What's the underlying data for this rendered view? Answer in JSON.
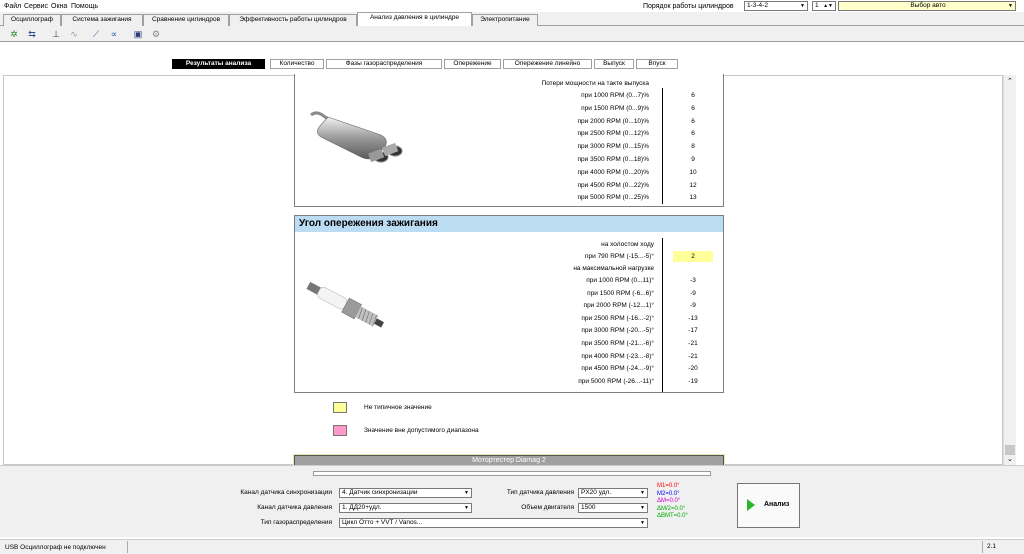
{
  "menu": {
    "items": [
      "Файл",
      "Сервис",
      "Окна",
      "Помощь"
    ]
  },
  "top_right": {
    "firing_order_label": "Порядок работы цилиндров",
    "firing_order_value": "1-3-4-2",
    "cylinder_value": "1",
    "auto_select": "Выбор авто"
  },
  "main_tabs": [
    "Осциллограф",
    "Система зажигания",
    "Сравнение цилиндров",
    "Эффективность работы цилиндров",
    "Анализ давления в цилиндре",
    "Электропитание"
  ],
  "active_main_tab": 4,
  "sub_tabs": [
    "Результаты анализа",
    "Количество",
    "Фазы газораспределения",
    "Опережение",
    "Опережение линейно",
    "Выпуск",
    "Впуск"
  ],
  "active_sub_tab": 0,
  "exhaust_panel": {
    "header": "Потери мощности на такте выпуска",
    "rows": [
      {
        "label": "при  1000 RPM (0...7)%",
        "value": "6"
      },
      {
        "label": "при  1500 RPM (0...9)%",
        "value": "6"
      },
      {
        "label": "при  2000 RPM (0...10)%",
        "value": "6"
      },
      {
        "label": "при  2500 RPM (0...12)%",
        "value": "6"
      },
      {
        "label": "при  3000 RPM (0...15)%",
        "value": "8"
      },
      {
        "label": "при  3500 RPM (0...18)%",
        "value": "9"
      },
      {
        "label": "при  4000 RPM (0...20)%",
        "value": "10"
      },
      {
        "label": "при  4500 RPM (0...22)%",
        "value": "12"
      },
      {
        "label": "при  5000 RPM (0...25)%",
        "value": "13"
      }
    ]
  },
  "ignition_panel": {
    "title": "Угол опережения зажигания",
    "idle_header": "на холостом ходу",
    "idle_row": {
      "label": "при 790 RPM (-15...-5)°",
      "value": "2"
    },
    "load_header": "на максимальной нагрузке",
    "rows": [
      {
        "label": "при 1000 RPM (0...11)°",
        "value": "-3"
      },
      {
        "label": "при 1500 RPM (-6...6)°",
        "value": "-9"
      },
      {
        "label": "при 2000 RPM (-12...1)°",
        "value": "-9"
      },
      {
        "label": "при 2500 RPM (-16...-2)°",
        "value": "-13"
      },
      {
        "label": "при 3000 RPM (-20...-5)°",
        "value": "-17"
      },
      {
        "label": "при 3500 RPM (-21...-6)°",
        "value": "-21"
      },
      {
        "label": "при 4000 RPM (-23...-8)°",
        "value": "-21"
      },
      {
        "label": "при 4500 RPM (-24...-9)°",
        "value": "-20"
      },
      {
        "label": "при 5000 RPM (-26...-11)°",
        "value": "-19"
      }
    ]
  },
  "legend": {
    "atypical": "Не типичное значение",
    "out_of_range": "Значение вне допустимого диапазона",
    "atypical_color": "#ffff99",
    "out_of_range_color": "#ff99cc"
  },
  "footer_bar": "Мотортестер Diamag 2",
  "settings": {
    "sync_label": "Канал датчика синхронизации",
    "sync_value": "4.  Датчик синхронизации",
    "pressure_label": "Канал датчика давления",
    "pressure_value": "1.  ДД20+удл.",
    "timing_label": "Тип газораспределения",
    "timing_value": "Цикл Отто + VVT / Vanos...",
    "sensor_type_label": "Тип датчика давления",
    "sensor_type_value": "PX20 удл.",
    "volume_label": "Объем двигателя",
    "volume_value": "1500"
  },
  "markers": {
    "m1": "M1=0.0°",
    "m2": "M2=0.0°",
    "dm": "ΔM=0.0°",
    "dm2": "ΔM/2=0.0°",
    "dbmt": "ΔВМТ=0.0°",
    "colors": {
      "m1": "#ff0000",
      "m2": "#0000ff",
      "dm": "#cc00cc",
      "dm2": "#00aa00",
      "dbmt": "#00aa00"
    }
  },
  "analyze_button": "Анализ",
  "status": {
    "left": "USB Осциллограф не подключен",
    "right": "2.1"
  }
}
